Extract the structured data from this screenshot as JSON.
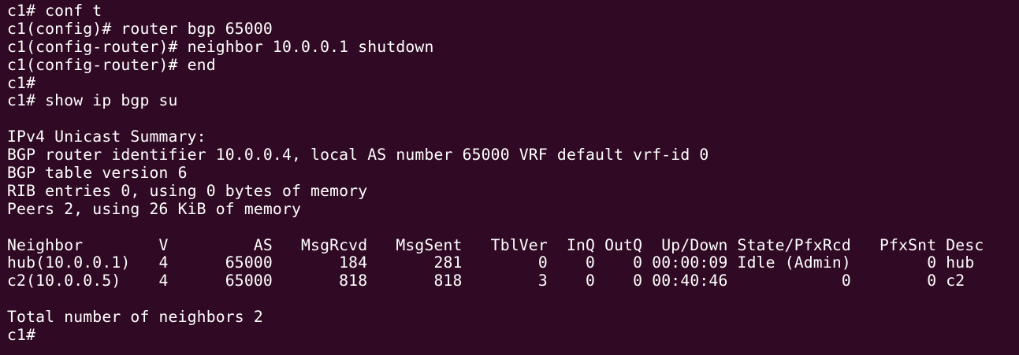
{
  "terminal": {
    "background": "#300a24",
    "foreground": "#ffffff",
    "lines": [
      "c1# conf t",
      "c1(config)# router bgp 65000",
      "c1(config-router)# neighbor 10.0.0.1 shutdown",
      "c1(config-router)# end",
      "c1#",
      "c1# show ip bgp su",
      "",
      "IPv4 Unicast Summary:",
      "BGP router identifier 10.0.0.4, local AS number 65000 VRF default vrf-id 0",
      "BGP table version 6",
      "RIB entries 0, using 0 bytes of memory",
      "Peers 2, using 26 KiB of memory",
      "",
      "Neighbor        V         AS   MsgRcvd   MsgSent   TblVer  InQ OutQ  Up/Down State/PfxRcd   PfxSnt Desc",
      "hub(10.0.0.1)   4      65000       184       281        0    0    0 00:00:09 Idle (Admin)        0 hub",
      "c2(10.0.0.5)    4      65000       818       818        3    0    0 00:40:46            0        0 c2",
      "",
      "Total number of neighbors 2",
      "c1#"
    ]
  }
}
